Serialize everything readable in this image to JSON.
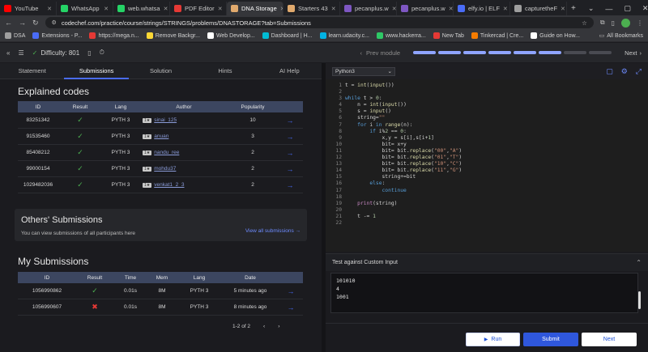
{
  "browser": {
    "tabs": [
      {
        "label": "YouTube",
        "color": "#ff0000",
        "active": false
      },
      {
        "label": "WhatsApp",
        "color": "#25d366",
        "active": false
      },
      {
        "label": "web.whatsa",
        "color": "#25d366",
        "active": false
      },
      {
        "label": "PDF Editor",
        "color": "#e53935",
        "active": false
      },
      {
        "label": "DNA Storage",
        "color": "#e0a96d",
        "active": true
      },
      {
        "label": "Starters 43",
        "color": "#e0a96d",
        "active": false
      },
      {
        "label": "pecanplus.w",
        "color": "#7e57c2",
        "active": false
      },
      {
        "label": "pecanplus.w",
        "color": "#7e57c2",
        "active": false
      },
      {
        "label": "elfy.io | ELF",
        "color": "#4a6cf7",
        "active": false
      },
      {
        "label": "capturetheF",
        "color": "#9e9e9e",
        "active": false
      }
    ],
    "url": "codechef.com/practice/course/strings/STRINGS/problems/DNASTORAGE?tab=Submissions",
    "bookmarks": [
      {
        "label": "DSA",
        "color": "#9e9e9e"
      },
      {
        "label": "Extensions - P...",
        "color": "#4a6cf7"
      },
      {
        "label": "https://mega.n...",
        "color": "#e53935"
      },
      {
        "label": "Remove Backgr...",
        "color": "#fdd835"
      },
      {
        "label": "Web Develop...",
        "color": "#ffffff"
      },
      {
        "label": "Dashboard | H...",
        "color": "#00bcd4"
      },
      {
        "label": "learn.udacity.c...",
        "color": "#02b3e4"
      },
      {
        "label": "www.hackerra...",
        "color": "#2ec866"
      },
      {
        "label": "New Tab",
        "color": "#e53935"
      },
      {
        "label": "Tinkercad | Cre...",
        "color": "#f57c00"
      },
      {
        "label": "Guide on How...",
        "color": "#ffffff"
      }
    ],
    "all_bookmarks": "All Bookmarks"
  },
  "topbar": {
    "difficulty_label": "Difficulty: 801",
    "prev_module": "Prev module",
    "next_module": "Next",
    "progress_segments": [
      true,
      true,
      true,
      true,
      true,
      true,
      false,
      false
    ]
  },
  "leftnav": {
    "items": [
      "Statement",
      "Submissions",
      "Solution",
      "Hints",
      "AI Help"
    ],
    "active": "Submissions"
  },
  "explained": {
    "title": "Explained codes",
    "headers": [
      "ID",
      "Result",
      "Lang",
      "Author",
      "Popularity"
    ],
    "rows": [
      {
        "id": "83251342",
        "lang": "PYTH 3",
        "stars": "1★",
        "author": "sinai_125",
        "popularity": "10"
      },
      {
        "id": "91535460",
        "lang": "PYTH 3",
        "stars": "1★",
        "author": "anuan",
        "popularity": "3"
      },
      {
        "id": "85408212",
        "lang": "PYTH 3",
        "stars": "1★",
        "author": "nandu_ree",
        "popularity": "2"
      },
      {
        "id": "99000154",
        "lang": "PYTH 3",
        "stars": "1★",
        "author": "mohdu37",
        "popularity": "2"
      },
      {
        "id": "1029482036",
        "lang": "PYTH 3",
        "stars": "1★",
        "author": "venkat1_2_3",
        "popularity": "2"
      }
    ]
  },
  "others": {
    "title": "Others' Submissions",
    "subtitle": "You can view submissions of all participants here",
    "link": "View all submissions →"
  },
  "my": {
    "title": "My Submissions",
    "headers": [
      "ID",
      "Result",
      "Time",
      "Mem",
      "Lang",
      "Date"
    ],
    "rows": [
      {
        "id": "1056990862",
        "result": "pass",
        "time": "0.01s",
        "mem": "8M",
        "lang": "PYTH 3",
        "date": "5 minutes ago"
      },
      {
        "id": "1056990607",
        "result": "fail",
        "time": "0.01s",
        "mem": "8M",
        "lang": "PYTH 3",
        "date": "8 minutes ago"
      }
    ],
    "pager": "1-2 of 2"
  },
  "editor": {
    "language": "Python3",
    "line_numbers": [
      "1",
      "2",
      "3",
      "4",
      "5",
      "6",
      "7",
      "8",
      "9",
      "10",
      "11",
      "12",
      "13",
      "14",
      "15",
      "16",
      "17",
      "18",
      "19",
      "20",
      "21",
      "22"
    ]
  },
  "custom": {
    "title": "Test against Custom Input",
    "lines": [
      "101010",
      "4",
      "1001"
    ]
  },
  "buttons": {
    "run": "Run",
    "submit": "Submit",
    "next": "Next"
  }
}
